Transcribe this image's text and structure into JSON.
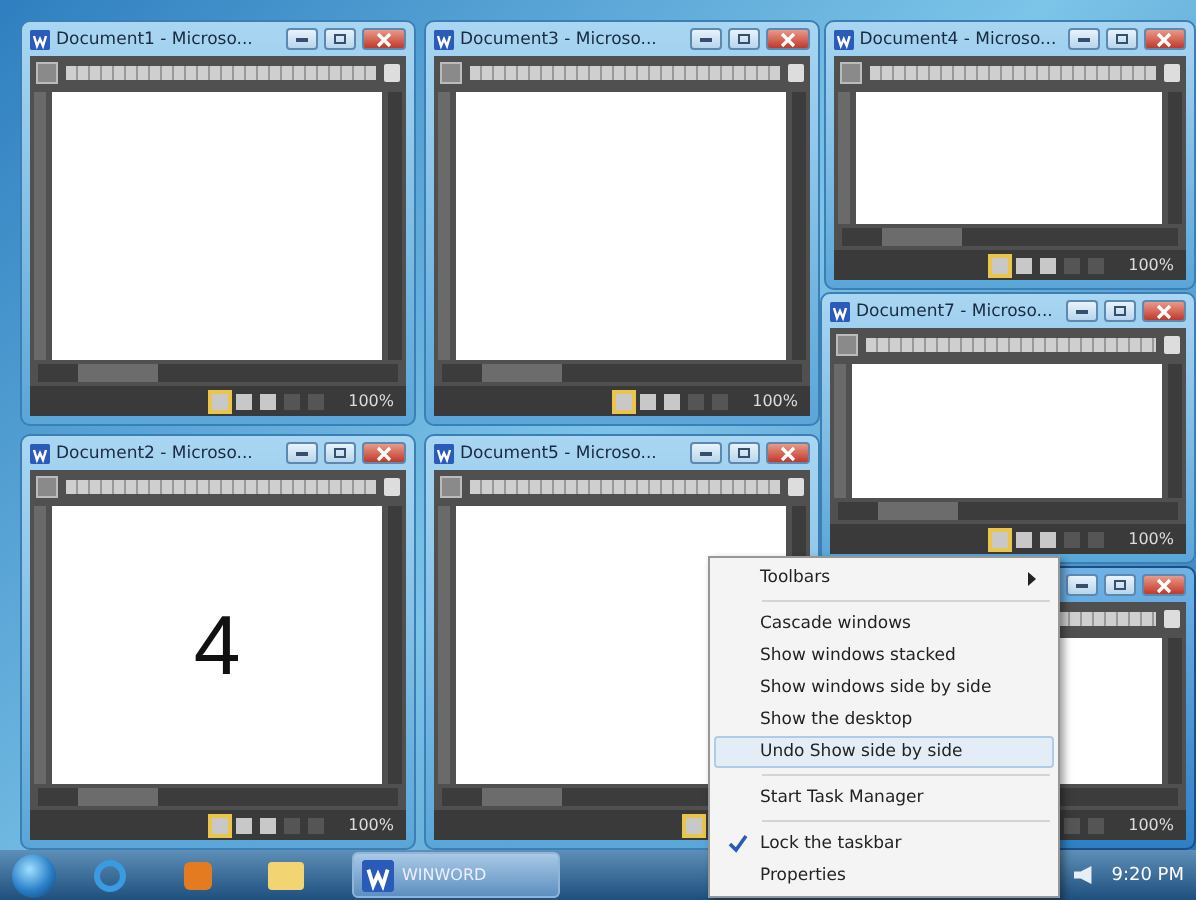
{
  "windows": [
    {
      "title": "Document1 - Microso...",
      "zoom": "100%",
      "active": false
    },
    {
      "title": "Document3 - Microso...",
      "zoom": "100%",
      "active": false
    },
    {
      "title": "Document4 - Microso...",
      "zoom": "100%",
      "active": false
    },
    {
      "title": "Document7 - Microso...",
      "zoom": "100%",
      "active": false
    },
    {
      "title": "Document2 - Microso...",
      "zoom": "100%",
      "active": false,
      "page_text": "4"
    },
    {
      "title": "Document5 - Microso...",
      "active": false
    },
    {
      "zoom": "100%",
      "active": true
    }
  ],
  "context_menu": [
    {
      "kind": "submenu",
      "label": "Toolbars",
      "selected": false
    },
    {
      "kind": "separator"
    },
    {
      "kind": "item",
      "label": "Cascade windows",
      "selected": false
    },
    {
      "kind": "item",
      "label": "Show windows stacked",
      "selected": false
    },
    {
      "kind": "item",
      "label": "Show windows side by side",
      "selected": false
    },
    {
      "kind": "item",
      "label": "Show the desktop",
      "selected": false
    },
    {
      "kind": "item",
      "label": "Undo Show side by side",
      "selected": true
    },
    {
      "kind": "separator"
    },
    {
      "kind": "item",
      "label": "Start Task Manager",
      "selected": false
    },
    {
      "kind": "separator"
    },
    {
      "kind": "check",
      "label": "Lock the taskbar",
      "selected": false,
      "checked": true
    },
    {
      "kind": "item",
      "label": "Properties",
      "selected": false
    }
  ],
  "taskbar": {
    "buttons": [
      {
        "label": "WINWORD",
        "selected": true
      }
    ],
    "clock": "9:20 PM"
  }
}
